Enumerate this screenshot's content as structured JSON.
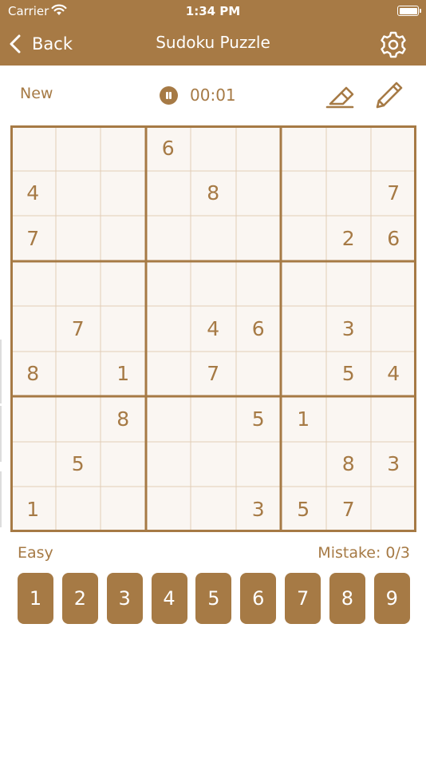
{
  "status_bar": {
    "carrier": "Carrier",
    "time": "1:34 PM"
  },
  "nav": {
    "back_label": "Back",
    "title": "Sudoku Puzzle"
  },
  "toolbar": {
    "new_label": "New",
    "timer": "00:01"
  },
  "board": {
    "grid": [
      [
        0,
        0,
        0,
        6,
        0,
        0,
        0,
        0,
        0
      ],
      [
        4,
        0,
        0,
        0,
        8,
        0,
        0,
        0,
        7
      ],
      [
        7,
        0,
        0,
        0,
        0,
        0,
        0,
        2,
        6
      ],
      [
        0,
        0,
        0,
        0,
        0,
        0,
        0,
        0,
        0
      ],
      [
        0,
        7,
        0,
        0,
        4,
        6,
        0,
        3,
        0
      ],
      [
        8,
        0,
        1,
        0,
        7,
        0,
        0,
        5,
        4
      ],
      [
        0,
        0,
        8,
        0,
        0,
        5,
        1,
        0,
        0
      ],
      [
        0,
        5,
        0,
        0,
        0,
        0,
        0,
        8,
        3
      ],
      [
        1,
        0,
        0,
        0,
        0,
        3,
        5,
        7,
        0
      ]
    ]
  },
  "footer": {
    "difficulty": "Easy",
    "mistake": "Mistake: 0/3"
  },
  "numpad": [
    "1",
    "2",
    "3",
    "4",
    "5",
    "6",
    "7",
    "8",
    "9"
  ],
  "colors": {
    "accent": "#a77a45",
    "board_bg": "#faf6f2",
    "grid_line": "#e2cdb6",
    "text": "#a67a45"
  }
}
